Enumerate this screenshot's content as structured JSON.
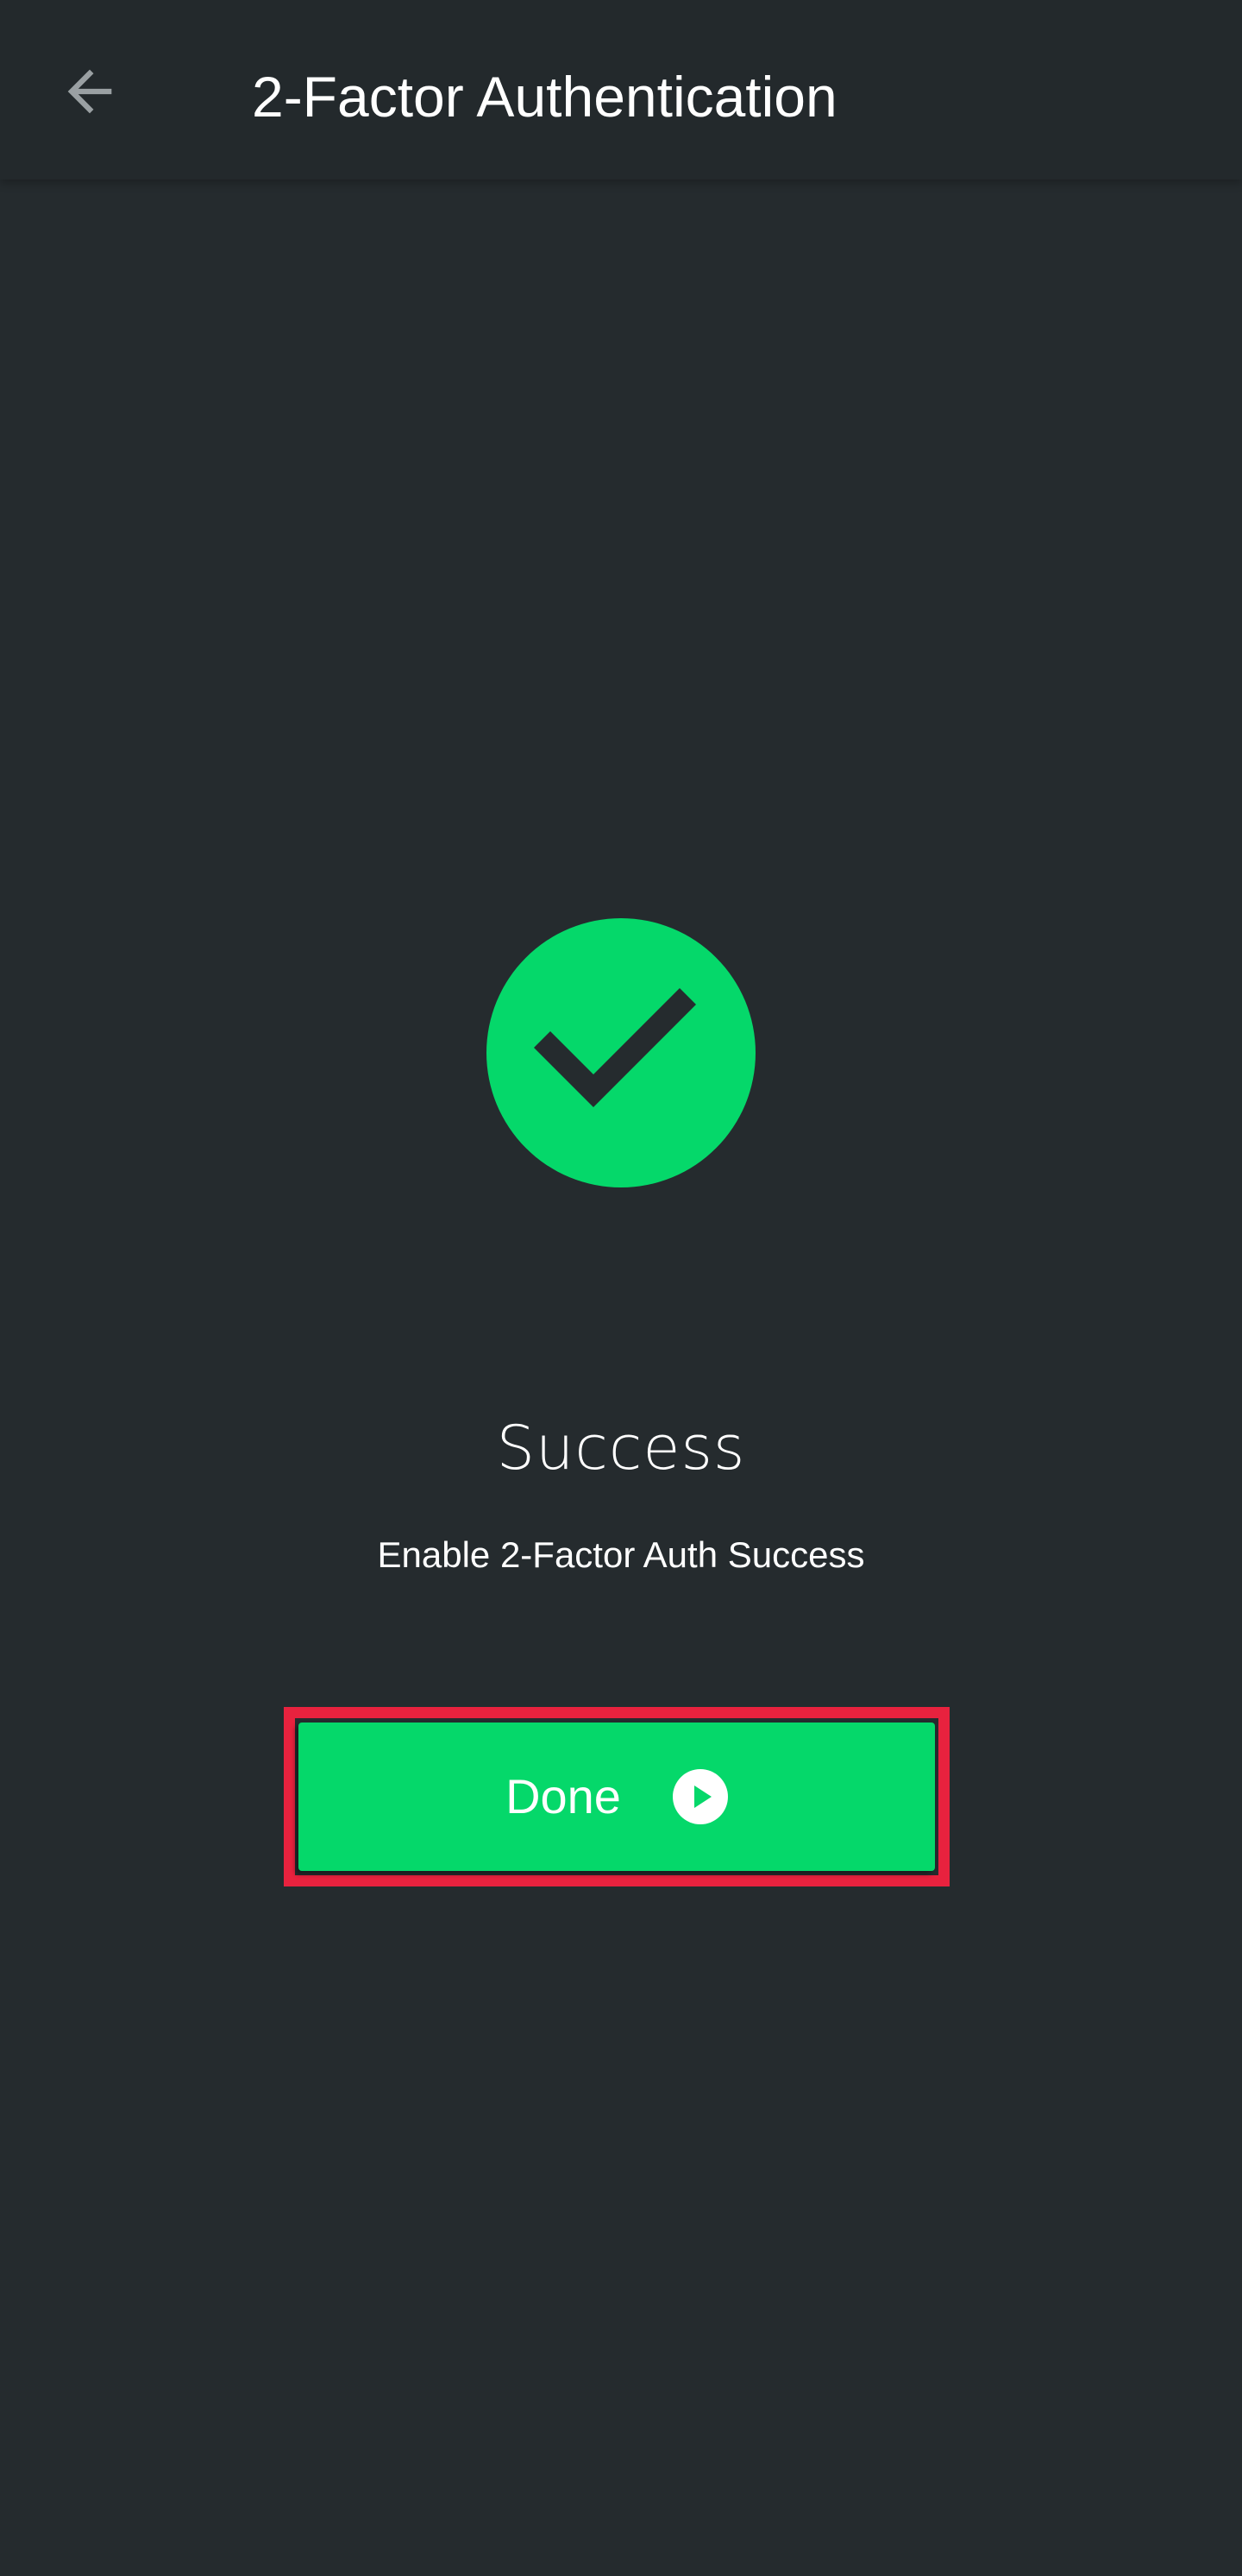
{
  "header": {
    "title": "2-Factor Authentication",
    "back_icon": "arrow-left-icon"
  },
  "status": {
    "icon": "check-circle-icon",
    "heading": "Success",
    "message": "Enable 2-Factor Auth Success"
  },
  "actions": {
    "done_label": "Done",
    "done_icon": "play-circle-icon"
  },
  "colors": {
    "background": "#252b2e",
    "app_bar": "#23292c",
    "accent": "#05d86a",
    "highlight": "#e8223e",
    "text": "#ffffff",
    "back_icon": "#9aa0a3"
  }
}
